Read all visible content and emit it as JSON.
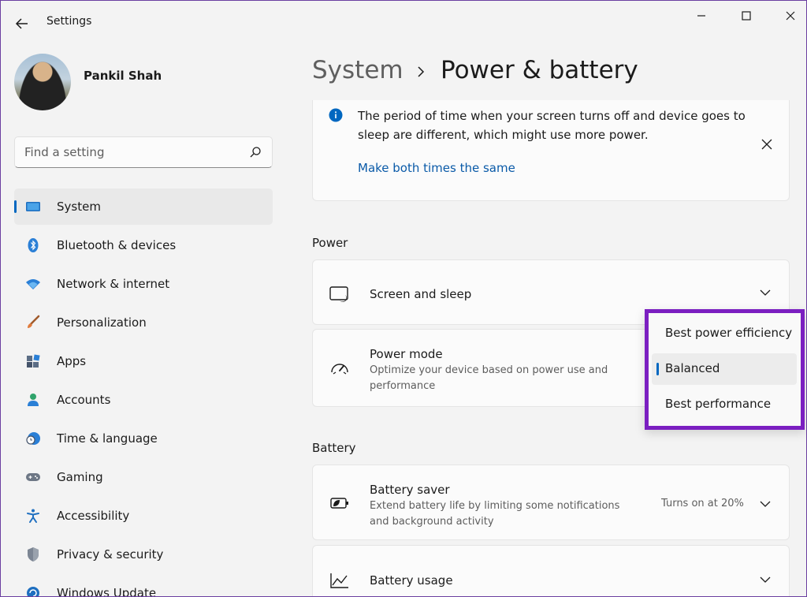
{
  "window": {
    "title": "Settings"
  },
  "user": {
    "name": "Pankil Shah"
  },
  "search": {
    "placeholder": "Find a setting"
  },
  "sidebar": {
    "items": [
      {
        "label": "System",
        "icon": "monitor-icon",
        "active": true
      },
      {
        "label": "Bluetooth & devices",
        "icon": "bluetooth-icon"
      },
      {
        "label": "Network & internet",
        "icon": "wifi-icon"
      },
      {
        "label": "Personalization",
        "icon": "brush-icon"
      },
      {
        "label": "Apps",
        "icon": "apps-icon"
      },
      {
        "label": "Accounts",
        "icon": "person-icon"
      },
      {
        "label": "Time & language",
        "icon": "clock-globe-icon"
      },
      {
        "label": "Gaming",
        "icon": "gamepad-icon"
      },
      {
        "label": "Accessibility",
        "icon": "accessibility-icon"
      },
      {
        "label": "Privacy & security",
        "icon": "shield-icon"
      },
      {
        "label": "Windows Update",
        "icon": "update-icon"
      }
    ]
  },
  "breadcrumb": {
    "root": "System",
    "current": "Power & battery"
  },
  "info": {
    "text": "The period of time when your screen turns off and device goes to sleep are different, which might use more power.",
    "link": "Make both times the same"
  },
  "power": {
    "section_title": "Power",
    "screen_sleep": {
      "title": "Screen and sleep"
    },
    "power_mode": {
      "title": "Power mode",
      "description": "Optimize your device based on power use and performance"
    }
  },
  "power_mode_menu": {
    "options": [
      "Best power efficiency",
      "Balanced",
      "Best performance"
    ],
    "selected": "Balanced"
  },
  "battery": {
    "section_title": "Battery",
    "saver": {
      "title": "Battery saver",
      "description": "Extend battery life by limiting some notifications and background activity",
      "status": "Turns on at 20%"
    },
    "usage": {
      "title": "Battery usage"
    }
  },
  "colors": {
    "accent": "#0067c0",
    "highlight_border": "#7b1fc1",
    "link": "#0a5aa8"
  }
}
